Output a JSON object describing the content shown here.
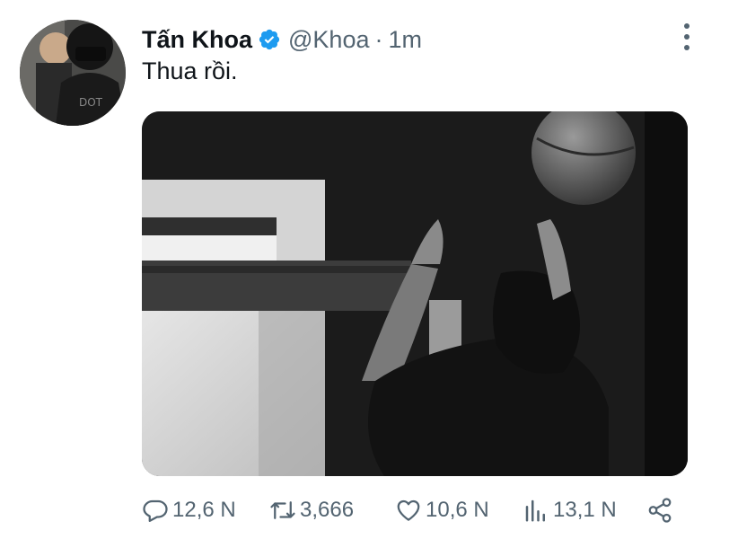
{
  "tweet": {
    "author_name": "Tấn Khoa",
    "handle": "@Khoa",
    "separator": "·",
    "timestamp": "1m",
    "text": "Thua rồi."
  },
  "actions": {
    "replies": "12,6 N",
    "retweets": "3,666",
    "likes": "10,6 N",
    "views": "13,1 N"
  },
  "icons": {
    "verified": "verified-badge-icon",
    "more": "more-vertical-icon",
    "reply": "reply-icon",
    "retweet": "retweet-icon",
    "like": "heart-icon",
    "views": "views-chart-icon",
    "share": "share-icon"
  },
  "colors": {
    "verified_blue": "#1d9bf0",
    "muted_gray": "#536471",
    "text_black": "#0f1419"
  }
}
